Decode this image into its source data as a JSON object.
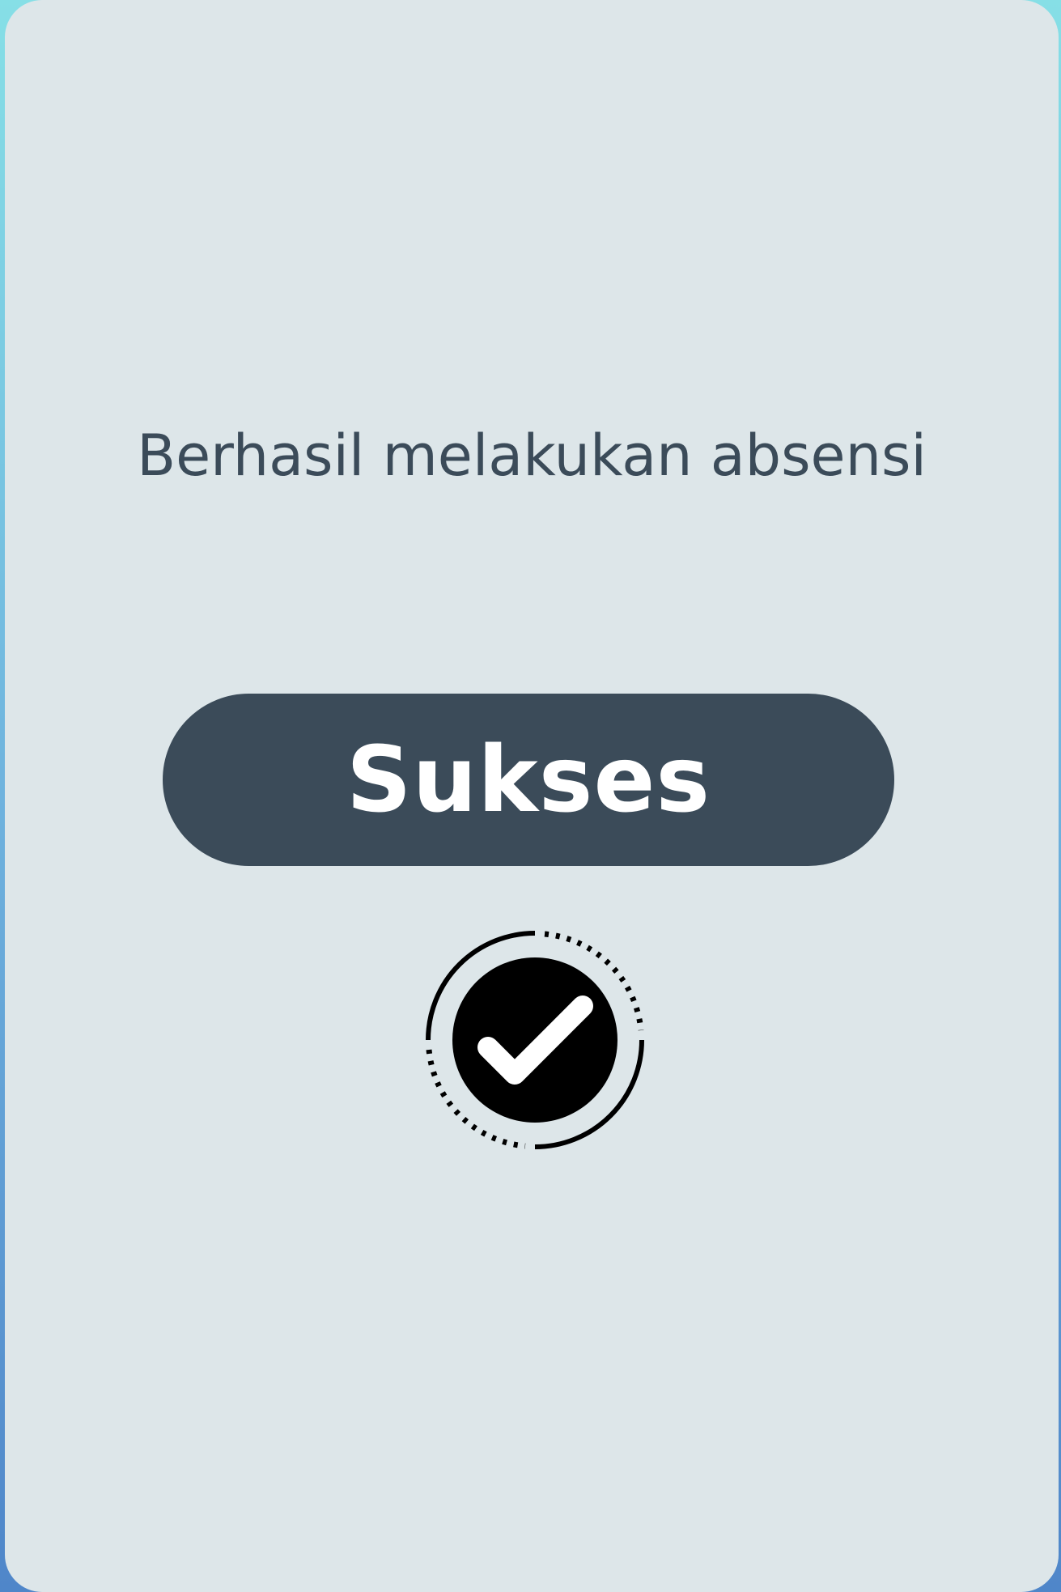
{
  "dialog": {
    "message": "Berhasil melakukan absensi",
    "status_label": "Sukses",
    "icon": "check-circle-icon"
  },
  "colors": {
    "card_background": "#dde6e9",
    "text": "#3b4b59",
    "pill": "#3b4b59",
    "pill_text": "#ffffff",
    "icon": "#000000"
  }
}
